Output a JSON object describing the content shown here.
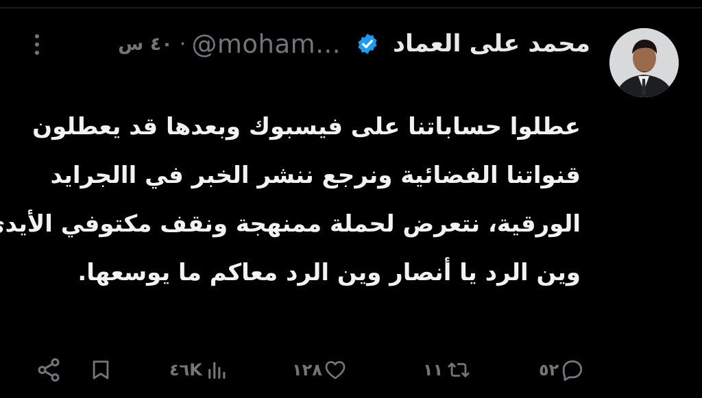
{
  "tweet": {
    "author": {
      "name": "محمد على العماد",
      "handle": "@moham...",
      "verified": true,
      "avatar_icon": "person-avatar-icon"
    },
    "separator": "·",
    "time": "٤٠ س",
    "lines": [
      "عطلوا حساباتنا على فيسبوك وبعدها  قد يعطلون",
      "قنواتنا الفضائية ونرجع ننشر الخبر في االجرايد",
      "الورقية، نتعرض لحملة ممنهجة ونقف مكتوفي الأيدي",
      "وين الرد يا أنصار وين الرد معاكم ما يوسعها."
    ]
  },
  "actions": {
    "replies": "٥٢",
    "retweets": "١١",
    "likes": "١٢٨",
    "views": "٤٦K"
  },
  "colors": {
    "background": "#000000",
    "text": "#e7e9ea",
    "muted": "#71767b",
    "verified": "#1d9bf0"
  }
}
